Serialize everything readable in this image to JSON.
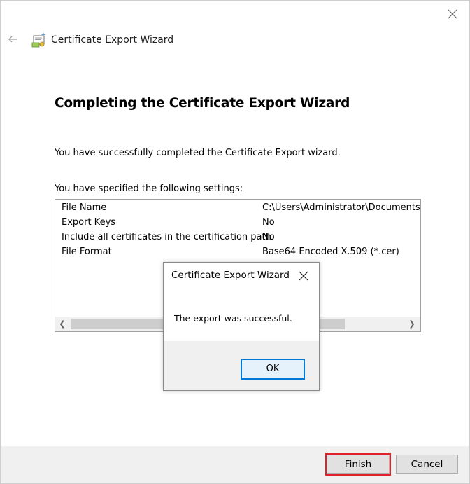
{
  "window": {
    "title": "Certificate Export Wizard",
    "heading": "Completing the Certificate Export Wizard",
    "message_completed": "You have successfully completed the Certificate Export wizard.",
    "message_settings": "You have specified the following settings:"
  },
  "settings": {
    "rows": [
      {
        "key": "File Name",
        "value": "C:\\Users\\Administrator\\Documents\\m"
      },
      {
        "key": "Export Keys",
        "value": "No"
      },
      {
        "key": "Include all certificates in the certification path",
        "value": "No"
      },
      {
        "key": "File Format",
        "value": "Base64 Encoded X.509 (*.cer)"
      }
    ]
  },
  "buttons": {
    "finish": "Finish",
    "cancel": "Cancel"
  },
  "dialog": {
    "title": "Certificate Export Wizard",
    "message": "The export was successful.",
    "ok": "OK"
  },
  "icons": {
    "close": "close-icon",
    "back": "back-arrow-icon",
    "wizard": "certificate-icon",
    "scroll_left": "chevron-left-icon",
    "scroll_right": "chevron-right-icon"
  },
  "colors": {
    "finish_highlight": "#e0202a",
    "ok_border": "#0078d7"
  }
}
